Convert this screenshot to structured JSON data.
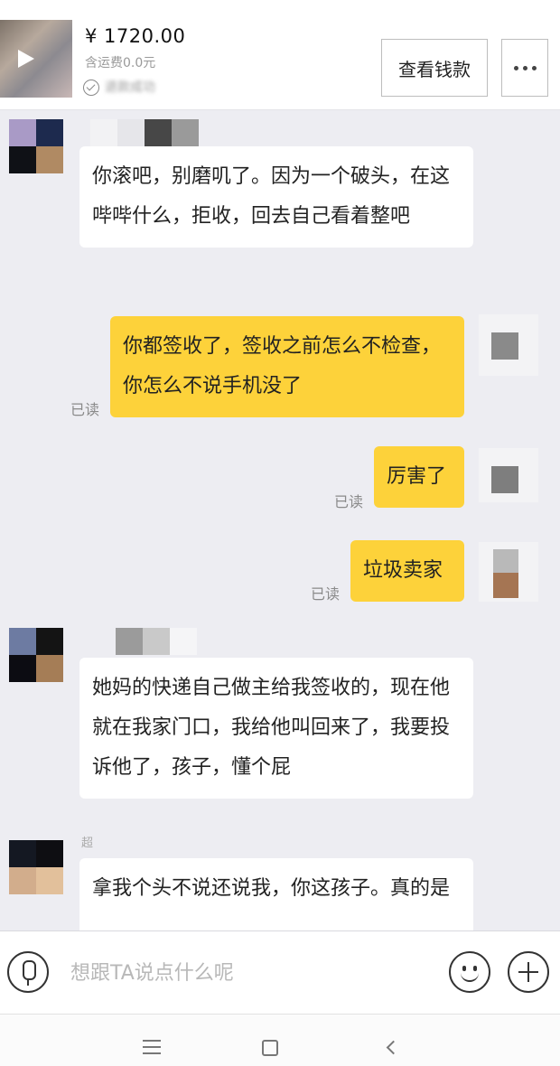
{
  "order": {
    "price": "¥ 1720.00",
    "shipping": "含运费0.0元",
    "status": "退款成功",
    "view_button": "查看钱款"
  },
  "messages": [
    {
      "side": "in",
      "text": "你滚吧，别磨叽了。因为一个破头，在这哔哔什么，拒收，回去自己看着整吧"
    },
    {
      "side": "out",
      "text": "你都签收了，签收之前怎么不检查，你怎么不说手机没了",
      "read": "已读"
    },
    {
      "side": "out",
      "text": "厉害了",
      "read": "已读"
    },
    {
      "side": "out",
      "text": "垃圾卖家",
      "read": "已读"
    },
    {
      "side": "in",
      "text": "她妈的快递自己做主给我签收的，现在他就在我家门口，我给他叫回来了，我要投诉他了，孩子，懂个屁"
    },
    {
      "side": "in",
      "name": "超",
      "text": "拿我个头不说还说我，你这孩子。真的是"
    }
  ],
  "input": {
    "placeholder": "想跟TA说点什么呢"
  },
  "icons": {
    "mic": "microphone-icon",
    "emoji": "emoji-icon",
    "plus": "plus-icon",
    "more": "more-dots-icon",
    "play": "play-icon",
    "check": "check-circle-icon"
  },
  "colors": {
    "outgoing_bubble": "#fdd23a",
    "incoming_bubble": "#ffffff",
    "background": "#ededf2"
  }
}
